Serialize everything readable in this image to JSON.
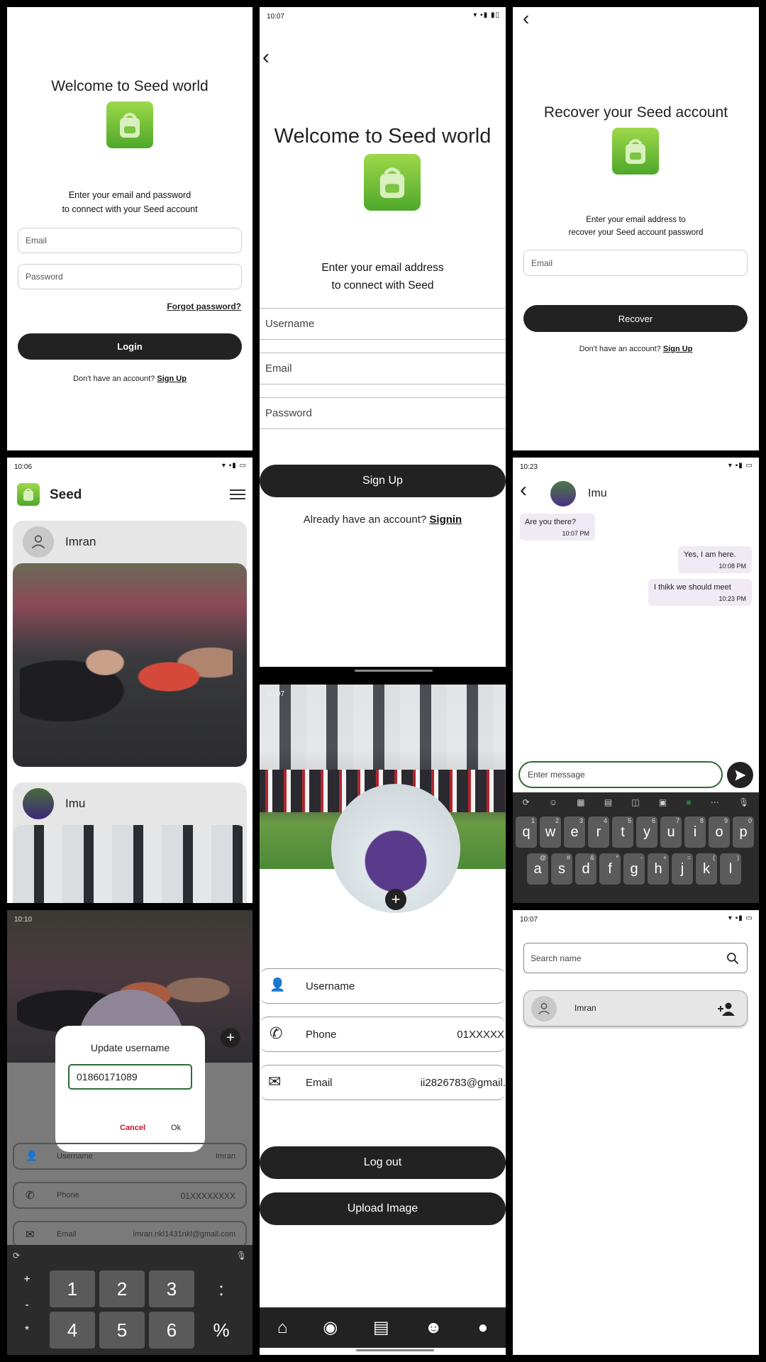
{
  "login": {
    "title": "Welcome to Seed world",
    "instruction_1": "Enter your email and password",
    "instruction_2": "to connect with your Seed account",
    "email_placeholder": "Email",
    "password_placeholder": "Password",
    "forgot": "Forgot password?",
    "login_button": "Login",
    "no_account": "Don't have an account?",
    "signup_link": "Sign Up"
  },
  "signup": {
    "time": "10:07",
    "title": "Welcome to Seed world",
    "instruction_1": "Enter your email address",
    "instruction_2": "to connect with Seed",
    "username_placeholder": "Username",
    "email_placeholder": "Email",
    "password_placeholder": "Password",
    "signup_button": "Sign Up",
    "have_account": "Already have an account?",
    "signin_link": "Signin"
  },
  "recover": {
    "title": "Recover your Seed account",
    "instruction_1": "Enter your email address to",
    "instruction_2": "recover your Seed account password",
    "email_placeholder": "Email",
    "recover_button": "Recover",
    "no_account": "Don't have an account?",
    "signup_link": "Sign Up"
  },
  "feed": {
    "time": "10:06",
    "app_name": "Seed",
    "posts": [
      {
        "author": "Imran"
      },
      {
        "author": "Imu"
      }
    ]
  },
  "chat": {
    "time": "10:23",
    "contact": "Imu",
    "messages": [
      {
        "text": "Are you there?",
        "time": "10:07 PM",
        "side": "in"
      },
      {
        "text": "Yes, I am here.",
        "time": "10:08 PM",
        "side": "out"
      },
      {
        "text": "I thikk we should meet",
        "time": "10:23 PM",
        "side": "out"
      }
    ],
    "input_placeholder": "Enter message",
    "keyboard_row1": [
      "q",
      "w",
      "e",
      "r",
      "t",
      "y",
      "u",
      "i",
      "o",
      "p"
    ],
    "keyboard_row1_alt": [
      "1",
      "2",
      "3",
      "4",
      "5",
      "6",
      "7",
      "8",
      "9",
      "0"
    ],
    "keyboard_row2": [
      "a",
      "s",
      "d",
      "f",
      "g",
      "h",
      "j",
      "k",
      "l"
    ],
    "keyboard_row2_alt": [
      "@",
      "#",
      "&",
      "*",
      "-",
      "+",
      "=",
      "(",
      ")"
    ]
  },
  "update_dialog": {
    "time": "10:10",
    "title": "Update username",
    "value": "01860171089",
    "cancel": "Cancel",
    "ok": "Ok",
    "username_label": "Username",
    "username_value": "Imran",
    "phone_label": "Phone",
    "phone_value": "01XXXXXXXX",
    "email_label": "Email",
    "email_value": "imran.nkl1431nkl@gmail.com",
    "numpad": [
      [
        "1",
        "2",
        "3",
        ":"
      ],
      [
        "4",
        "5",
        "6",
        "%"
      ]
    ],
    "numpad_side": [
      "+",
      "-",
      "*"
    ]
  },
  "profile": {
    "time": "10:07",
    "username_label": "Username",
    "phone_label": "Phone",
    "phone_value": "01XXXXX",
    "email_label": "Email",
    "email_value": "ii2826783@gmail.",
    "logout_button": "Log out",
    "upload_button": "Upload Image"
  },
  "search": {
    "time": "10:07",
    "placeholder": "Search name",
    "result_name": "Imran"
  },
  "colors": {
    "dark": "#222222",
    "logo_green": "#6cbf35",
    "accent_red": "#c0182a",
    "field_green": "#2e6b34"
  }
}
